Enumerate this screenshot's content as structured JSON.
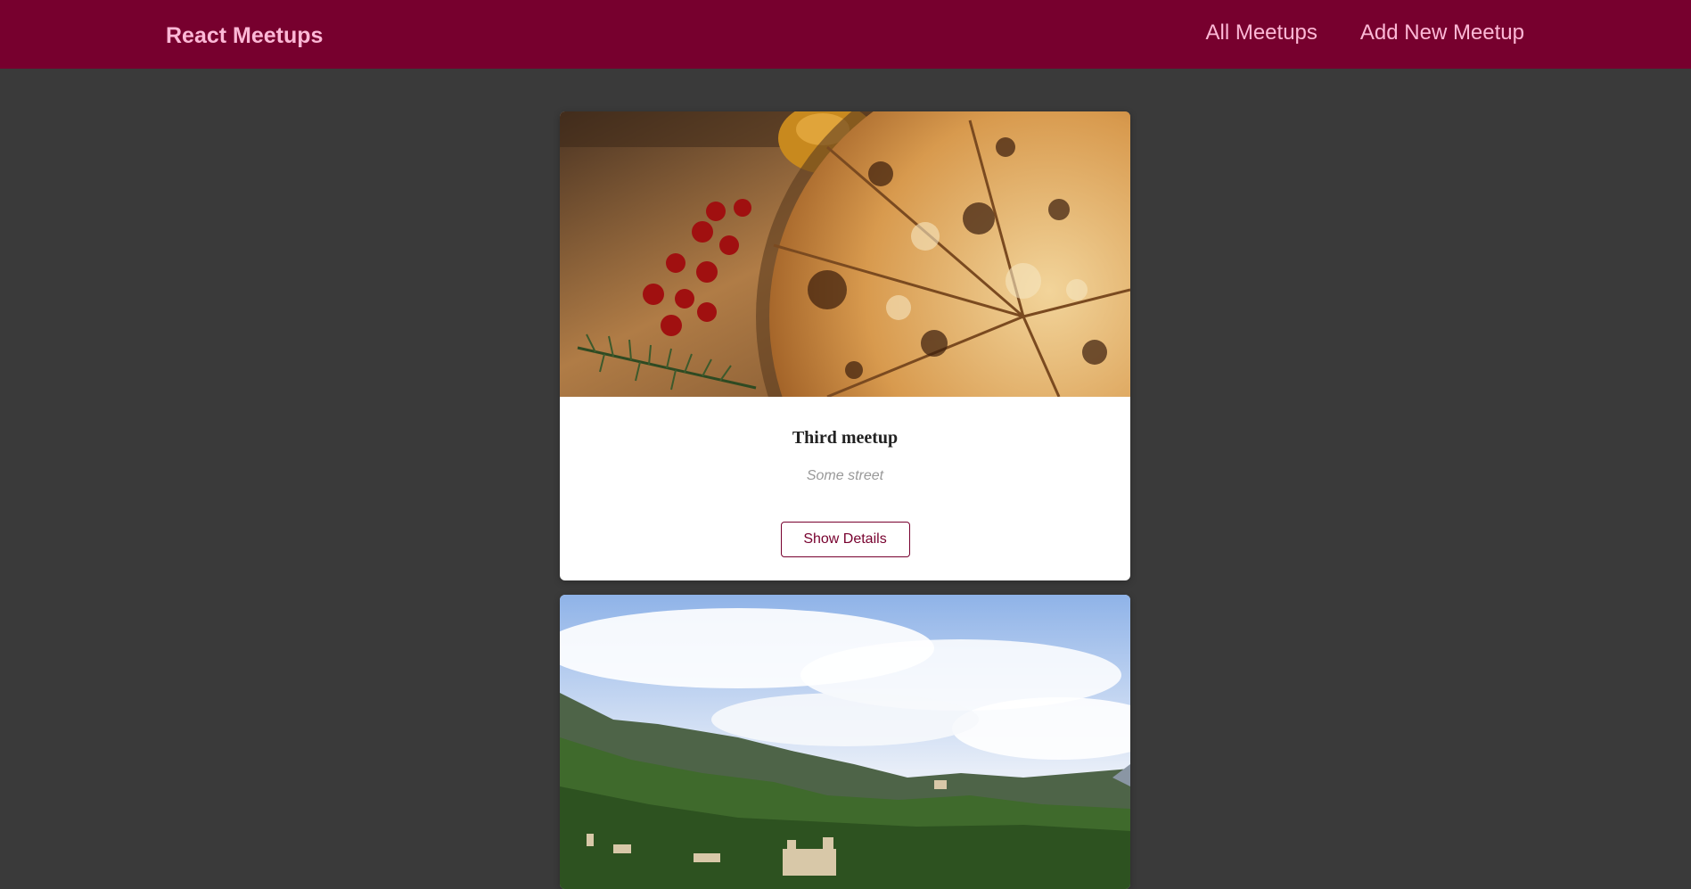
{
  "header": {
    "logo": "React Meetups",
    "nav": [
      {
        "label": "All Meetups"
      },
      {
        "label": "Add New Meetup"
      }
    ]
  },
  "meetups": [
    {
      "title": "Third meetup",
      "address": "Some street",
      "button_label": "Show Details"
    }
  ],
  "colors": {
    "brand": "#77002e",
    "nav_text": "#fcb8d6",
    "background": "#3a3a3a"
  }
}
